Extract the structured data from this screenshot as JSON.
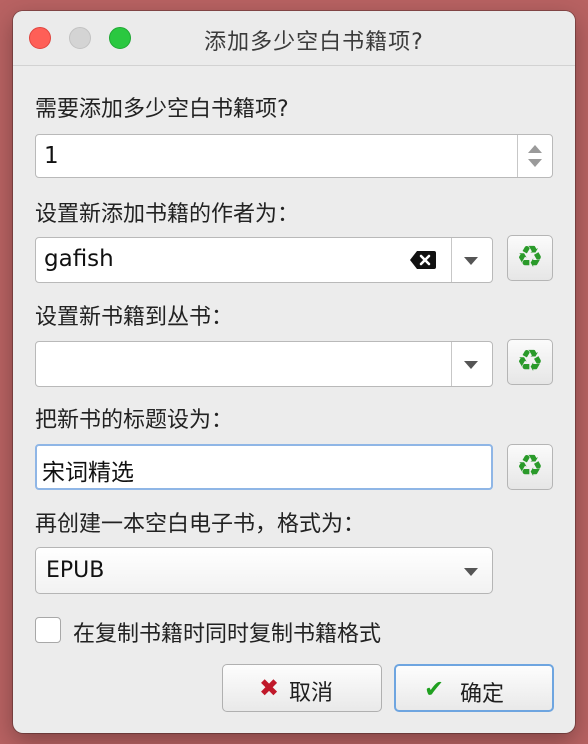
{
  "window": {
    "title": "添加多少空白书籍项?"
  },
  "count": {
    "label": "需要添加多少空白书籍项?",
    "value": "1"
  },
  "author": {
    "label": "设置新添加书籍的作者为：",
    "value": "gafish"
  },
  "series": {
    "label": "设置新书籍到丛书：",
    "value": ""
  },
  "book_title": {
    "label": "把新书的标题设为：",
    "value": "宋词精选"
  },
  "format": {
    "label": "再创建一本空白电子书，格式为：",
    "value": "EPUB"
  },
  "copy_formats": {
    "label": "在复制书籍时同时复制书籍格式",
    "checked": false
  },
  "buttons": {
    "cancel": "取消",
    "ok": "确定"
  },
  "colors": {
    "accent": "#6ea5e0",
    "recycle": "#2a9a2a",
    "cancel_icon": "#c0182a",
    "ok_icon": "#20a020"
  }
}
